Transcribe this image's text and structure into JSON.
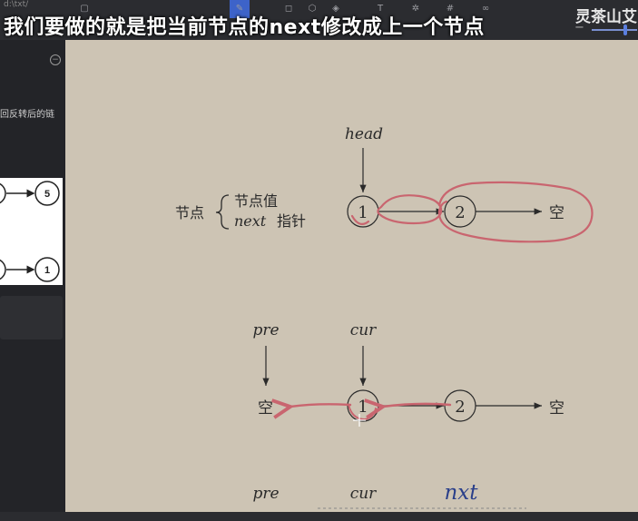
{
  "toolbar": {
    "path_label": "d:\\txt/",
    "tools": [
      "file-icon",
      "pen-icon",
      "box-icon",
      "cube-icon",
      "eraser-icon",
      "text-icon",
      "gear-icon",
      "frame-icon",
      "link-icon"
    ],
    "accent": "#3d63c9"
  },
  "subtitle": "我们要做的就是把当前节点的next修改成上一个节点",
  "watermark": "灵茶山艾",
  "sidebar": {
    "text": "回反转后的链",
    "thumbnail": {
      "row1_value": "5",
      "row2_value": "1"
    }
  },
  "diagram1": {
    "pointer_label": "head",
    "legend": {
      "title": "节点",
      "line1": "节点值",
      "line2_var": "next",
      "line2_text": "指针"
    },
    "nodes": [
      "1",
      "2"
    ],
    "null_label": "空"
  },
  "diagram2": {
    "pre_label": "pre",
    "cur_label": "cur",
    "left_null": "空",
    "nodes": [
      "1",
      "2"
    ],
    "right_null": "空"
  },
  "diagram3": {
    "pre_label": "pre",
    "cur_label": "cur",
    "nxt_label": "nxt"
  },
  "colors": {
    "canvas_bg": "#cdc4b4",
    "ink": "#2a2a2a",
    "annotation": "#c9656f",
    "nxt_blue": "#2a3f8a"
  }
}
